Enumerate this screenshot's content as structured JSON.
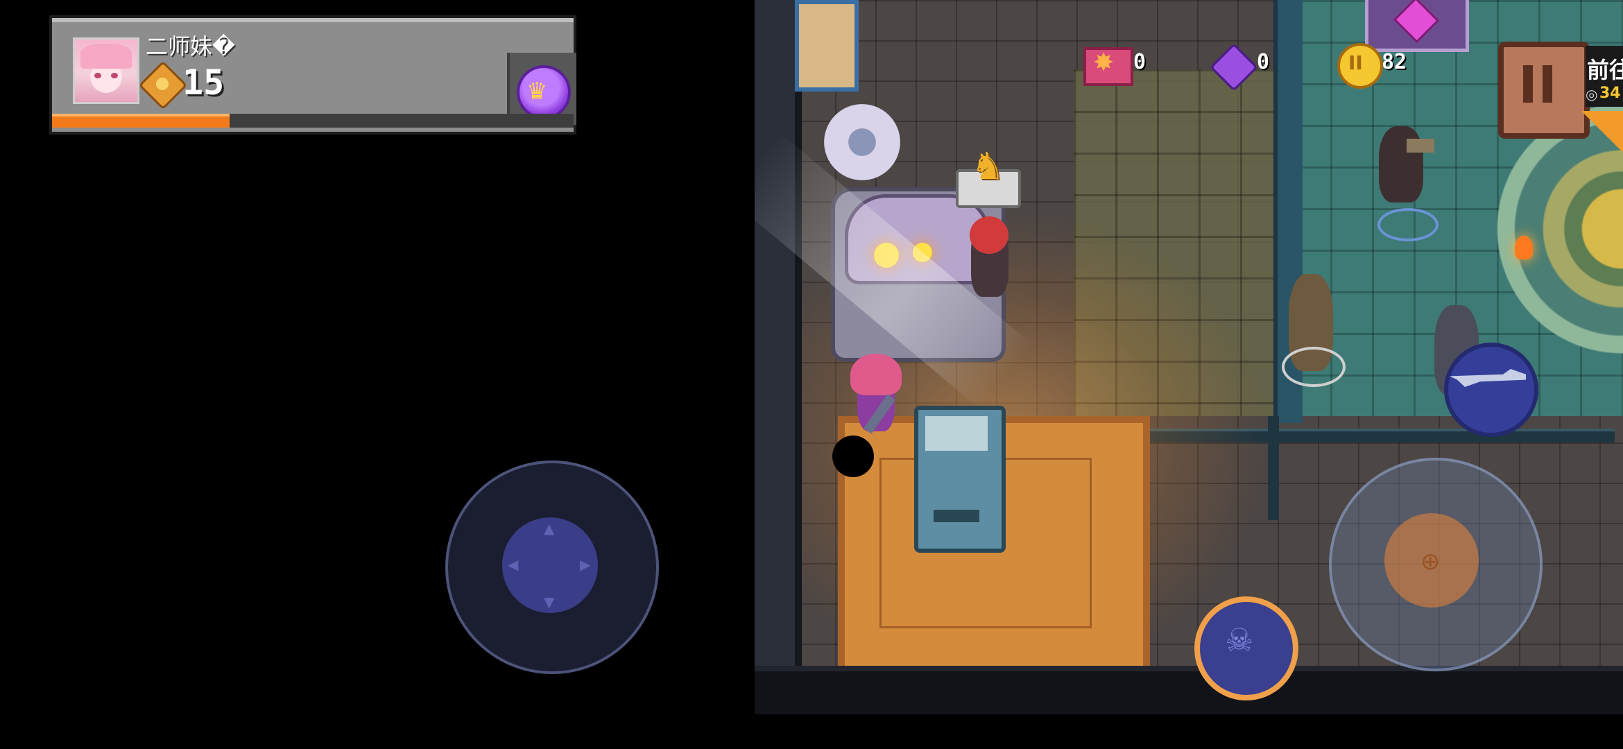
{
  "player": {
    "name": "二师妹�",
    "level": "15",
    "xp_progress": 0.34
  },
  "resources": {
    "tickets": "0",
    "gems": "0",
    "coins": "82"
  },
  "objective": {
    "title": "前往",
    "count": "34"
  },
  "icons": {
    "avatar": "anime-girl-avatar",
    "rank": "sun-rank-badge",
    "crown": "crown-badge",
    "ticket": "ticket-icon",
    "gem": "purple-gem-icon",
    "coin": "gold-coin-icon",
    "pause": "pause-icon",
    "skill": "lightning-skull-skill-icon",
    "weapon": "rifle-weapon-icon",
    "speech": "golden-statue-icon"
  },
  "colors": {
    "xp_fill": "#f27a1a",
    "skill_ring": "#f0a04a",
    "coin": "#f5c730",
    "gem": "#9b4fe0"
  }
}
